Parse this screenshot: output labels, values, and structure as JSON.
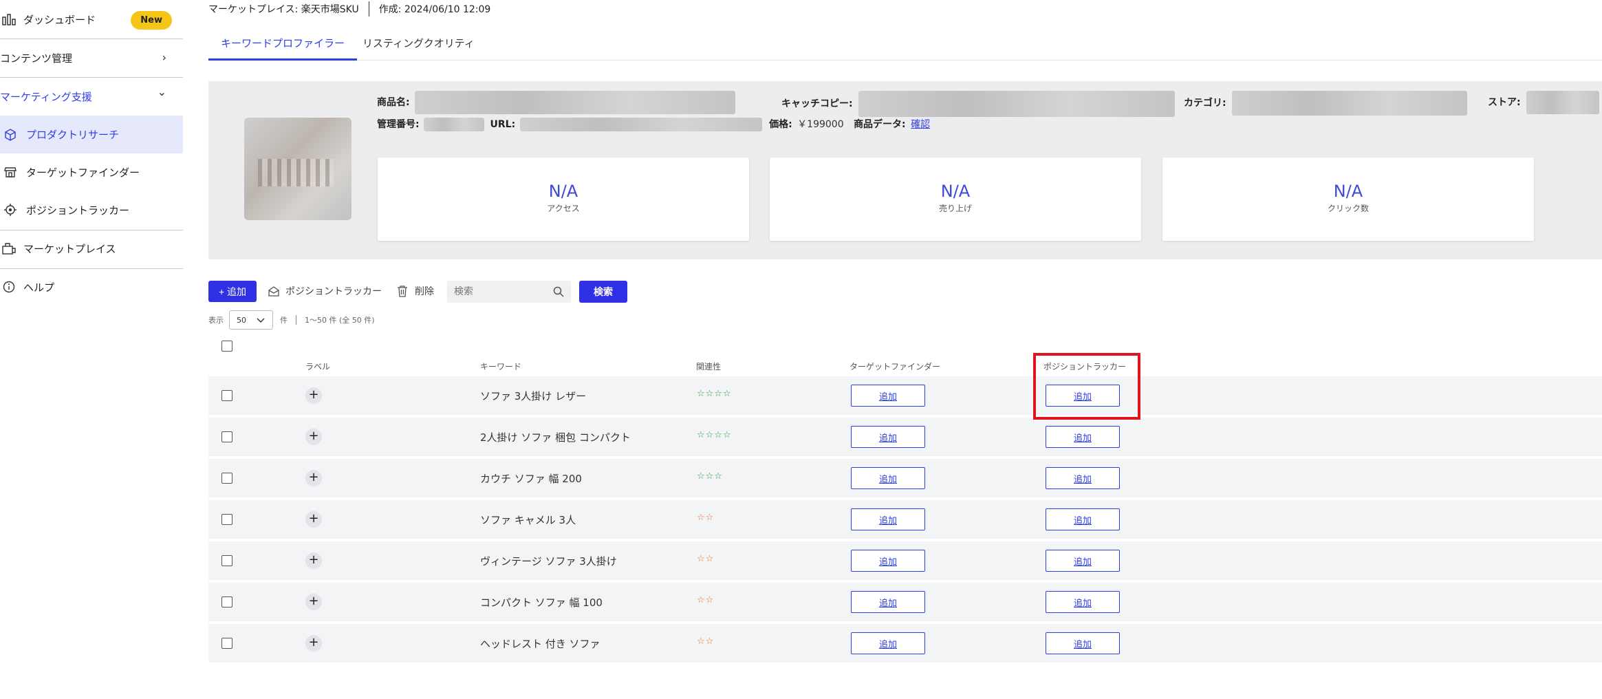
{
  "sidebar": {
    "items": [
      {
        "label": "ダッシュボード",
        "badge": "New"
      },
      {
        "label": "コンテンツ管理",
        "chevron": "›"
      },
      {
        "label": "マーケティング支援",
        "chevron": "⌄"
      },
      {
        "label": "プロダクトリサーチ"
      },
      {
        "label": "ターゲットファインダー"
      },
      {
        "label": "ポジショントラッカー"
      },
      {
        "label": "マーケットプレイス"
      },
      {
        "label": "ヘルプ"
      }
    ]
  },
  "header": {
    "marketplace": "マーケットプレイス: 楽天市場SKU",
    "created": "作成: 2024/06/10 12:09"
  },
  "tabs": [
    {
      "label": "キーワードプロファイラー",
      "active": true
    },
    {
      "label": "リスティングクオリティ",
      "active": false
    }
  ],
  "product": {
    "name_label": "商品名:",
    "catch_label": "キャッチコピー:",
    "category_label": "カテゴリ:",
    "store_label": "ストア:",
    "mgmt_label": "管理番号:",
    "url_label": "URL:",
    "price_label": "価格:",
    "price_value": "￥199000",
    "data_label": "商品データ:",
    "data_link": "確認"
  },
  "stats": [
    {
      "value": "N/A",
      "label": "アクセス"
    },
    {
      "value": "N/A",
      "label": "売り上げ"
    },
    {
      "value": "N/A",
      "label": "クリック数"
    }
  ],
  "toolbar": {
    "add": "+ 追加",
    "tracker": "ポジショントラッカー",
    "delete": "削除",
    "search_placeholder": "検索",
    "search_button": "検索"
  },
  "pager": {
    "show": "表示",
    "per_page": "50",
    "unit": "件",
    "range": "1～50 件 (全 50 件)"
  },
  "table": {
    "headers": {
      "label": "ラベル",
      "keyword": "キーワード",
      "relevance": "関連性",
      "target_finder": "ターゲットファインダー",
      "position_tracker": "ポジショントラッカー"
    },
    "add_label": "追加",
    "rows": [
      {
        "keyword": "ソファ 3人掛け レザー",
        "stars": "☆☆☆☆",
        "color": "#2e9e3e"
      },
      {
        "keyword": "2人掛け ソファ 梱包 コンパクト",
        "stars": "☆☆☆☆",
        "color": "#2e9e3e"
      },
      {
        "keyword": "カウチ ソファ 幅 200",
        "stars": "☆☆☆",
        "color": "#2e9e3e"
      },
      {
        "keyword": "ソファ キャメル 3人",
        "stars": "☆☆",
        "color": "#e8742a"
      },
      {
        "keyword": "ヴィンテージ ソファ 3人掛け",
        "stars": "☆☆",
        "color": "#e8742a"
      },
      {
        "keyword": "コンパクト ソファ 幅 100",
        "stars": "☆☆",
        "color": "#e8742a"
      },
      {
        "keyword": "ヘッドレスト 付き ソファ",
        "stars": "☆☆",
        "color": "#e8742a"
      }
    ]
  },
  "colors": {
    "accent": "#2c3de8",
    "primary_button": "#2f2fe6",
    "highlight": "#e0141e",
    "badge": "#f5c518"
  }
}
